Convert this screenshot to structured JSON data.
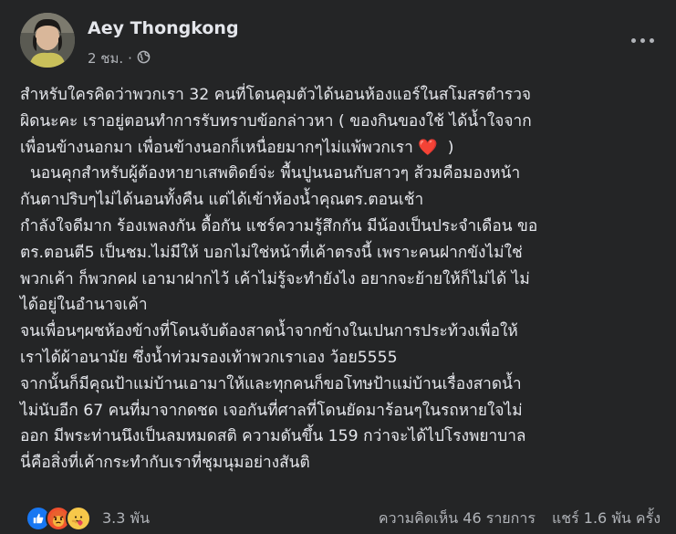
{
  "post": {
    "author": "Aey Thongkong",
    "time": "2 ชม.",
    "separator": "·",
    "audience_icon": "globe-icon",
    "more_icon": "more-dots-icon",
    "text_lines": [
      "สำหรับใครคิดว่าพวกเรา 32 คนที่โดนคุมตัวได้นอนห้องแอร์ในสโมสรตำรวจ",
      "ผิดนะคะ เราอยู่ตอนทำการรับทราบข้อกล่าวหา ( ของกินของใช้ ได้น้ำใจจาก",
      "เพื่อนข้างนอกมา เพื่อนข้างนอกก็เหนื่อยมากๆไม่แพ้พวกเรา",
      "  นอนคุกสำหรับผู้ต้องหายาเสพติดย์จ่ะ พื้นปูนนอนกับสาวๆ ส้วมคือมองหน้า",
      "กันตาปริบๆไม่ได้นอนทั้งคืน แต่ได้เข้าห้องน้ำคุณตร.ตอนเช้า",
      "กำลังใจดีมาก ร้องเพลงกัน ดื้อกัน แชร์ความรู้สึกกัน มีน้องเป็นประจำเดือน ขอ",
      "ตร.ตอนตี5 เป็นชม.ไม่มีให้ บอกไม่ใช่หน้าที่เค้าตรงนี้ เพราะคนฝากขังไม่ใช่",
      "พวกเค้า ก็พวกคฝ เอามาฝากไว้ เค้าไม่รู้จะทำยังไง อยากจะย้ายให้ก็ไม่ได้ ไม่",
      "ได้อยู่ในอำนาจเค้า",
      "จนเพื่อนๆผชห้องข้างที่โดนจับต้องสาดน้ำจากข้างในเปนการประท้วงเพื่อให้",
      "เราได้ผ้าอนามัย ซึ่งน้ำท่วมรองเท้าพวกเราเอง ว้อย5555",
      "จากนั้นก็มีคุณป้าแม่บ้านเอามาให้และทุกคนก็ขอโทษป้าแม่บ้านเรื่องสาดน้ำ",
      "ไม่นับอีก 67 คนที่มาจากดชด เจอกันที่ศาลที่โดนยัดมาร้อนๆในรถหายใจไม่",
      "ออก มีพระท่านนึงเป็นลมหมดสติ ความดันขึ้น 159 กว่าจะได้ไปโรงพยาบาล",
      "นี่คือสิ่งที่เค้ากระทำกับเราที่ชุมนุมอย่างสันติ"
    ],
    "heart_emoji": "❤️",
    "heart_close": "  )"
  },
  "footer": {
    "reactions": [
      "like",
      "angry",
      "care"
    ],
    "reaction_count": "3.3 พัน",
    "comments": "ความคิดเห็น 46 รายการ",
    "shares": "แชร์ 1.6 พัน ครั้ง"
  },
  "colors": {
    "background": "#242526",
    "primary_text": "#e4e6eb",
    "secondary_text": "#b0b3b8",
    "like": "#1877f2",
    "heart": "#e11d2b"
  }
}
